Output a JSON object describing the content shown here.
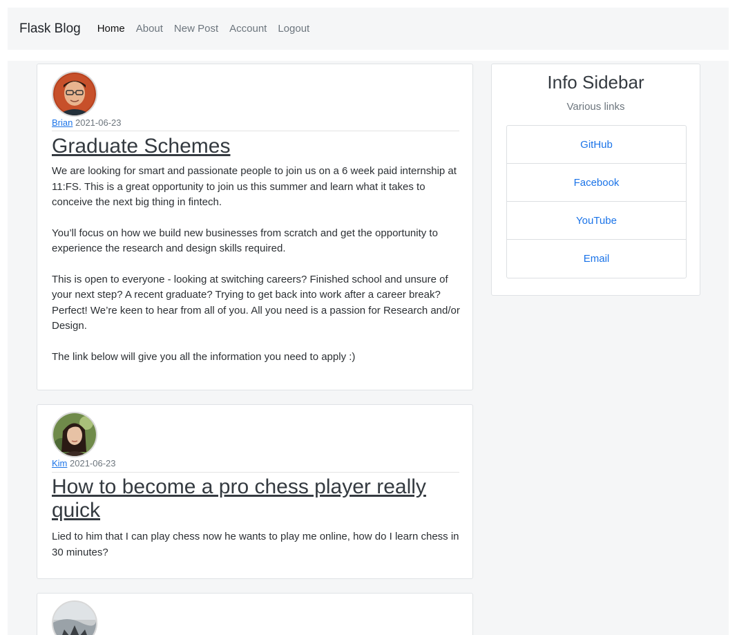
{
  "navbar": {
    "brand": "Flask Blog",
    "links": [
      "Home",
      "About",
      "New Post",
      "Account",
      "Logout"
    ]
  },
  "posts": [
    {
      "author": "Brian",
      "date": "2021-06-23",
      "title": "Graduate Schemes",
      "paragraphs": [
        "We are looking for smart and passionate people to join us on a 6 week paid internship at 11:FS. This is a great opportunity to join us this summer and learn what it takes to conceive the next big thing in fintech.",
        "You’ll focus on how we build new businesses from scratch and get the opportunity to experience the research and design skills required.",
        "This is open to everyone - looking at switching careers? Finished school and unsure of your next step? A recent graduate? Trying to get back into work after a career break? Perfect! We’re keen to hear from all of you. All you need is a passion for Research and/or Design.",
        "The link below will give you all the information you need to apply :)"
      ]
    },
    {
      "author": "Kim",
      "date": "2021-06-23",
      "title": "How to become a pro chess player really quick",
      "paragraphs": [
        "Lied to him that I can play chess now he wants to play me online, how do I learn chess in 30 minutes?"
      ]
    }
  ],
  "sidebar": {
    "title": "Info Sidebar",
    "subtitle": "Various links",
    "links": [
      "GitHub",
      "Facebook",
      "YouTube",
      "Email"
    ]
  }
}
